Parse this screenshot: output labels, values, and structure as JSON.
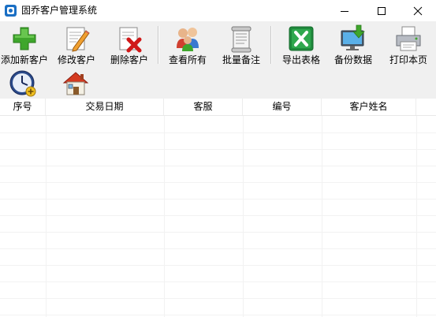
{
  "window": {
    "title": "固乔客户管理系统"
  },
  "toolbar": {
    "add_customer": "添加新客户",
    "edit_customer": "修改客户",
    "delete_customer": "删除客户",
    "view_all": "查看所有",
    "batch_note": "批量备注",
    "export_table": "导出表格",
    "backup_data": "备份数据",
    "print_page": "打印本页"
  },
  "table": {
    "columns": [
      "序号",
      "交易日期",
      "客服",
      "编号",
      "客户姓名"
    ],
    "rows": []
  },
  "colors": {
    "toolbar_bg": "#f0f0f0",
    "grid_line": "#f2f2f2"
  }
}
